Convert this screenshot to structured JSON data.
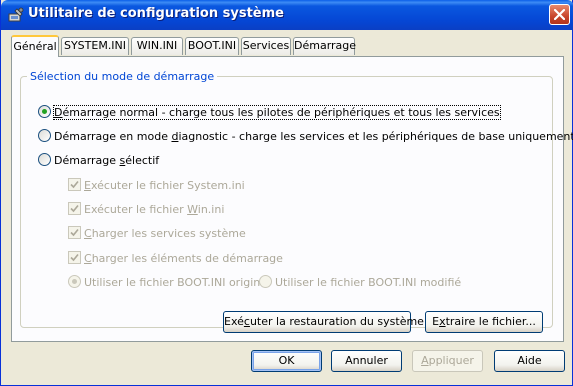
{
  "window": {
    "title": "Utilitaire de configuration système",
    "icon": "system-config-icon",
    "close_icon": "close-icon"
  },
  "tabs": [
    {
      "label": "Général",
      "active": true
    },
    {
      "label": "SYSTEM.INI",
      "active": false
    },
    {
      "label": "WIN.INI",
      "active": false
    },
    {
      "label": "BOOT.INI",
      "active": false
    },
    {
      "label": "Services",
      "active": false
    },
    {
      "label": "Démarrage",
      "active": false
    }
  ],
  "group": {
    "legend": "Sélection du mode de démarrage",
    "normal": {
      "pre": "",
      "accel": "D",
      "post": "émarrage normal - charge tous les pilotes de périphériques et tous les services",
      "checked": true
    },
    "diagnostic": {
      "pre": "Démarrage en mode ",
      "accel": "d",
      "post": "iagnostic - charge les services et les périphériques de base uniquement",
      "checked": false
    },
    "selective": {
      "pre": "Démarrage ",
      "accel": "s",
      "post": "électif",
      "checked": false
    },
    "sub_options": [
      {
        "pre": "",
        "accel": "E",
        "post": "xécuter le fichier System.ini",
        "checked": true
      },
      {
        "pre": "Exécuter le fichier ",
        "accel": "W",
        "post": "in.ini",
        "checked": true
      },
      {
        "pre": "",
        "accel": "C",
        "post": "harger les services système",
        "checked": true
      },
      {
        "pre": "",
        "accel": "C",
        "post": "harger les éléments de démarrage",
        "checked": true
      }
    ],
    "boot_original": {
      "label": "Utiliser le fichier BOOT.INI original",
      "checked": true
    },
    "boot_modified": {
      "label": "Utiliser le fichier BOOT.INI modifié",
      "checked": false
    },
    "restore_button": {
      "pre": "Exé",
      "accel": "c",
      "post": "uter la restauration du système"
    },
    "extract_button": {
      "pre": "E",
      "accel": "x",
      "post": "traire le fichier..."
    }
  },
  "footer": {
    "ok": "OK",
    "cancel": "Annuler",
    "apply": {
      "pre": "",
      "accel": "A",
      "post": "ppliquer"
    },
    "help": "Aide"
  }
}
